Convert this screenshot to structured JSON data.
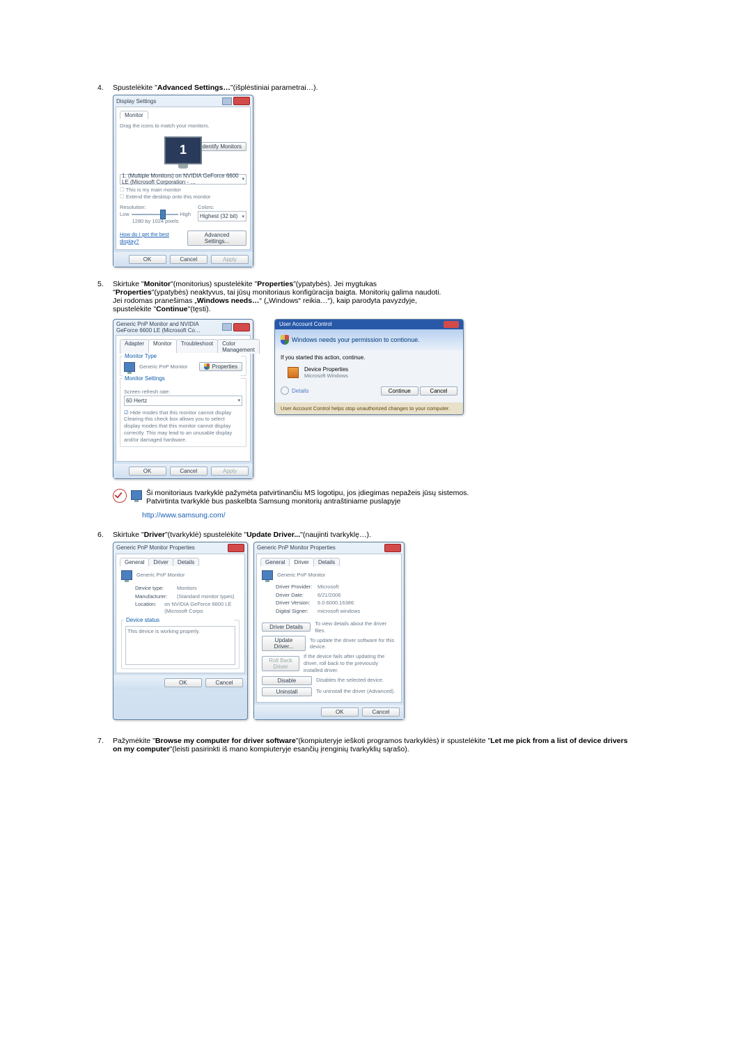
{
  "common": {
    "ok": "OK",
    "cancel": "Cancel",
    "apply": "Apply"
  },
  "steps": [
    {
      "num": "4.",
      "t1": "Spustelėkite \"",
      "b1": "Advanced Settings…",
      "t2": "\"(išplėstiniai parametrai…)."
    },
    {
      "num": "5.",
      "p1a": "Skirtuke \"",
      "p1b": "Monitor",
      "p1c": "\"(monitorius) spustelėkite \"",
      "p1d": "Properties",
      "p1e": "\"(ypatybės). Jei mygtukas",
      "p2a": "\"",
      "p2b": "Properties",
      "p2c": "\"(ypatybės) neaktyvus, tai jūsų monitoriaus konfigūracija baigta. Monitorių galima naudoti.",
      "p3a": "Jei rodomas pranešimas „",
      "p3b": "Windows needs…",
      "p3c": "“ („Windows“ reikia…“), kaip parodyta pavyzdyje,",
      "p4a": "spustelėkite \"",
      "p4b": "Continue",
      "p4c": "\"(tęsti)."
    },
    {
      "num": "6.",
      "a": "Skirtuke \"",
      "b": "Driver",
      "c": "\"(tvarkyklė) spustelėkite \"",
      "d": "Update Driver...",
      "e": "\"(naujinti tvarkyklę…)."
    },
    {
      "num": "7.",
      "a": "Pažymėkite \"",
      "b": "Browse my computer for driver software",
      "c": "\"(kompiuteryje ieškoti programos tvarkyklės) ir spustelėkite \"",
      "d": "Let me pick from a list of device drivers on my computer",
      "e": "\"(leisti pasirinkti iš mano kompiuteryje esančių įrenginių tvarkyklių sąrašo)."
    }
  ],
  "dlg_display": {
    "title": "Display Settings",
    "tab": "Monitor",
    "instr": "Drag the icons to match your monitors.",
    "identify": "Identify Monitors",
    "adapter": "1. (Multiple Monitors) on NVIDIA GeForce 6600 LE (Microsoft Corporation - …",
    "chk_main": "This is my main monitor",
    "chk_extend": "Extend the desktop onto this monitor",
    "res_label": "Resolution:",
    "low": "Low",
    "high": "High",
    "res_val": "1280 by 1024 pixels",
    "colors_label": "Colors:",
    "colors_val": "Highest (32 bit)",
    "help_link": "How do I get the best display?",
    "adv": "Advanced Settings..."
  },
  "dlg_monprops": {
    "title": "Generic PnP Monitor and NVIDIA GeForce 6600 LE (Microsoft Co…",
    "tabs": [
      "Adapter",
      "Monitor",
      "Troubleshoot",
      "Color Management"
    ],
    "montype": "Monitor Type",
    "montype_val": "Generic PnP Monitor",
    "props_btn": "Properties",
    "monsettings": "Monitor Settings",
    "refresh_label": "Screen refresh rate:",
    "refresh_val": "60 Hertz",
    "hide_modes": "Hide modes that this monitor cannot display",
    "hide_modes_desc": "Clearing this check box allows you to select display modes that this monitor cannot display correctly. This may lead to an unusable display and/or damaged hardware."
  },
  "uac": {
    "title": "User Account Control",
    "headline": "Windows needs your permission to contionue.",
    "if_started": "If you started this action, continue.",
    "app": "Device Properties",
    "pub": "Microsoft Windows",
    "details": "Details",
    "continue": "Continue",
    "footer": "User Account Control helps stop unauthorized changes to your computer."
  },
  "note": {
    "l1": "Ši monitoriaus tvarkyklė pažymėta patvirtinančiu MS logotipu, jos įdiegimas nepažeis jūsų sistemos.",
    "l2": "Patvirtinta tvarkyklė bus paskelbta Samsung monitorių antraštiniame puslapyje",
    "link": "http://www.samsung.com/"
  },
  "dlg_pnp": {
    "title": "Generic PnP Monitor Properties",
    "tabs": [
      "General",
      "Driver",
      "Details"
    ],
    "name": "Generic PnP Monitor",
    "gen": {
      "kv": [
        {
          "k": "Device type:",
          "v": "Monitors"
        },
        {
          "k": "Manufacturer:",
          "v": "(Standard monitor types)"
        },
        {
          "k": "Location:",
          "v": "on NVIDIA GeForce 6600 LE (Microsoft Corpo"
        }
      ],
      "status_label": "Device status",
      "status": "This device is working properly."
    },
    "drv": {
      "kv": [
        {
          "k": "Driver Provider:",
          "v": "Microsoft"
        },
        {
          "k": "Driver Date:",
          "v": "6/21/2006"
        },
        {
          "k": "Driver Version:",
          "v": "6.0.6000.16386"
        },
        {
          "k": "Digital Signer:",
          "v": "microsoft windows"
        }
      ],
      "btns": [
        {
          "label": "Driver Details",
          "desc": "To view details about the driver files."
        },
        {
          "label": "Update Driver...",
          "desc": "To update the driver software for this device."
        },
        {
          "label": "Roll Back Driver",
          "desc": "If the device fails after updating the driver, roll back to the previously installed driver."
        },
        {
          "label": "Disable",
          "desc": "Disables the selected device."
        },
        {
          "label": "Uninstall",
          "desc": "To uninstall the driver (Advanced)."
        }
      ]
    }
  }
}
